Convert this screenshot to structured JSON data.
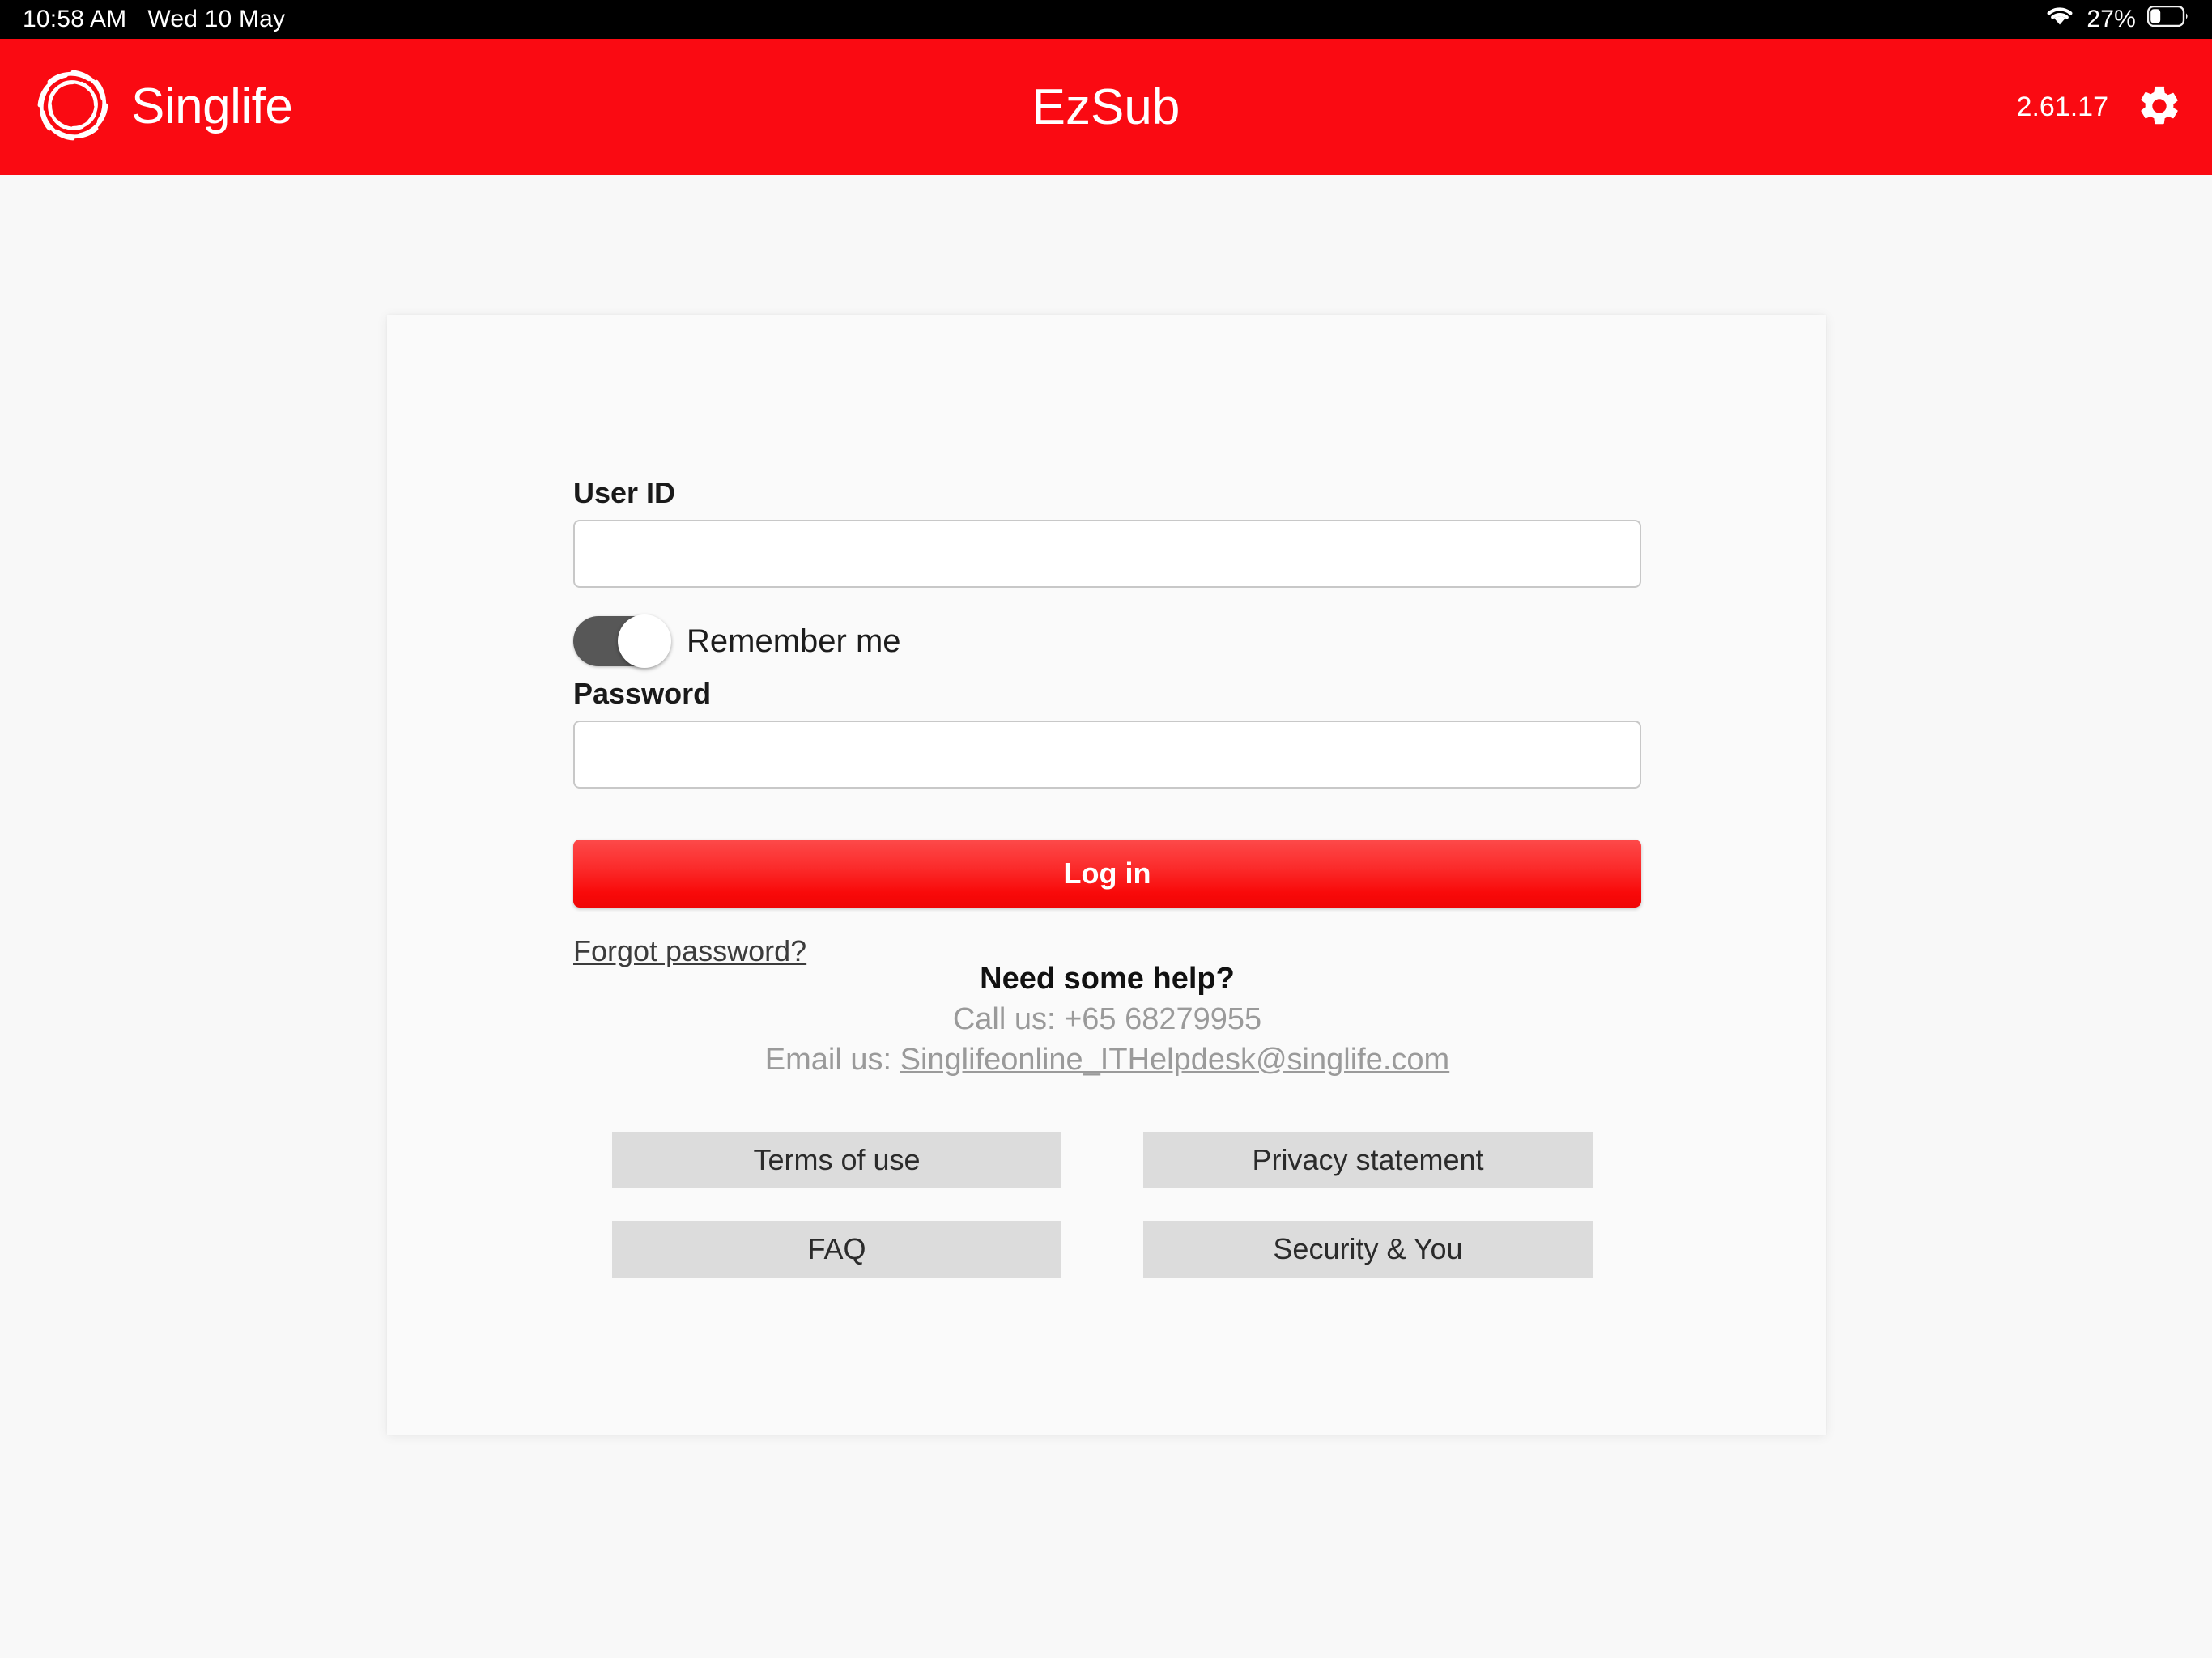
{
  "status_bar": {
    "time": "10:58 AM",
    "date": "Wed 10 May",
    "battery_percent": "27%",
    "battery_level": 27,
    "wifi_icon": "wifi-icon",
    "battery_icon": "battery-icon"
  },
  "header": {
    "brand": "Singlife",
    "logo_icon": "singlife-swirl-logo",
    "title": "EzSub",
    "version": "2.61.17",
    "settings_icon": "gear-icon",
    "background_color": "#fa0a12"
  },
  "form": {
    "user_id_label": "User ID",
    "user_id_value": "",
    "user_id_placeholder": "",
    "remember_me_label": "Remember me",
    "remember_me_on": true,
    "password_label": "Password",
    "password_value": "",
    "password_placeholder": "",
    "login_button": "Log in",
    "forgot_password": "Forgot password?"
  },
  "help": {
    "title": "Need some help?",
    "call_prefix": "Call us: ",
    "phone": "+65 68279955",
    "email_prefix": "Email us: ",
    "email": "Singlifeonline_ITHelpdesk@singlife.com"
  },
  "links": [
    {
      "label": "Terms of use"
    },
    {
      "label": "Privacy statement"
    },
    {
      "label": "FAQ"
    },
    {
      "label": "Security & You"
    }
  ],
  "colors": {
    "brand_red": "#fa0a12",
    "page_background": "#f8f8f8",
    "card_background": "#fafafa",
    "link_button": "#dcdcdc",
    "toggle_track": "#575757"
  }
}
